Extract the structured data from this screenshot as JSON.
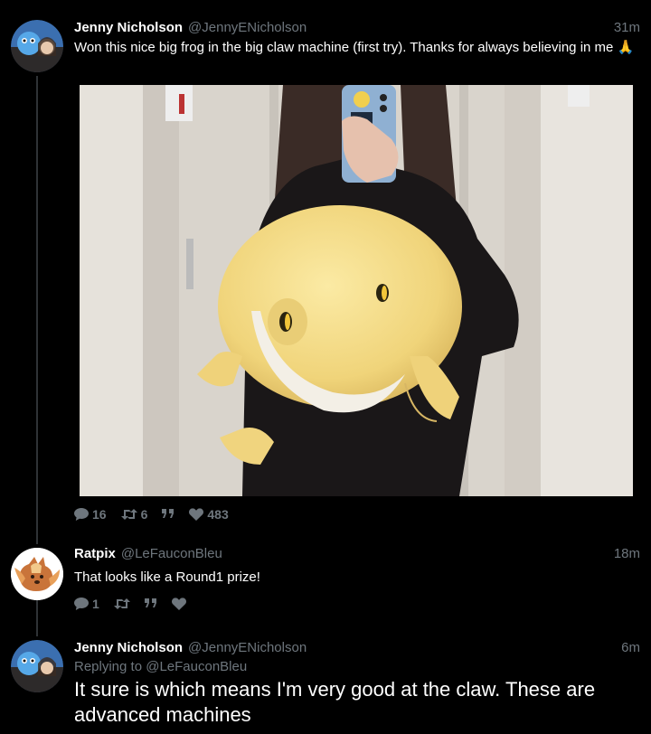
{
  "tweets": [
    {
      "name": "Jenny Nicholson",
      "handle": "@JennyENicholson",
      "time": "31m",
      "text": "Won this nice big frog in the big claw machine (first try). Thanks for always believing in me 🙏",
      "actions": {
        "replies": "16",
        "retweets": "6",
        "likes": "483"
      }
    },
    {
      "name": "Ratpix",
      "handle": "@LeFauconBleu",
      "time": "18m",
      "text": "That looks like a Round1 prize!",
      "actions": {
        "replies": "1",
        "retweets": "",
        "likes": ""
      }
    },
    {
      "name": "Jenny Nicholson",
      "handle": "@JennyENicholson",
      "time": "6m",
      "reply_label": "Replying to",
      "reply_to": "@LeFauconBleu",
      "text": "It sure is which means I'm very good at the claw. These are advanced machines"
    }
  ],
  "colors": {
    "background": "#000000",
    "muted": "#6e767d",
    "thread": "#2f3336",
    "frog": "#f4dd8a"
  },
  "icons": [
    "reply-icon",
    "retweet-icon",
    "quote-icon",
    "like-icon"
  ]
}
